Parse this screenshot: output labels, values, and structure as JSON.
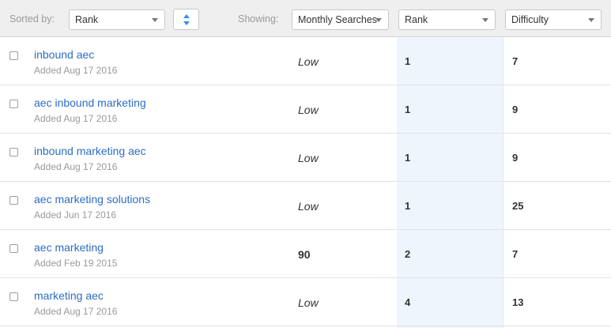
{
  "toolbar": {
    "sorted_by_label": "Sorted by:",
    "sorted_by_value": "Rank",
    "showing_label": "Showing:",
    "column_selects": [
      "Monthly Searches",
      "Rank",
      "Difficulty"
    ]
  },
  "rows": [
    {
      "keyword": "inbound aec",
      "added": "Added Aug 17 2016",
      "monthly_searches": "Low",
      "rank": "1",
      "difficulty": "7"
    },
    {
      "keyword": "aec inbound marketing",
      "added": "Added Aug 17 2016",
      "monthly_searches": "Low",
      "rank": "1",
      "difficulty": "9"
    },
    {
      "keyword": "inbound marketing aec",
      "added": "Added Aug 17 2016",
      "monthly_searches": "Low",
      "rank": "1",
      "difficulty": "9"
    },
    {
      "keyword": "aec marketing solutions",
      "added": "Added Jun 17 2016",
      "monthly_searches": "Low",
      "rank": "1",
      "difficulty": "25"
    },
    {
      "keyword": "aec marketing",
      "added": "Added Feb 19 2015",
      "monthly_searches": "90",
      "rank": "2",
      "difficulty": "7"
    },
    {
      "keyword": "marketing aec",
      "added": "Added Aug 17 2016",
      "monthly_searches": "Low",
      "rank": "4",
      "difficulty": "13"
    }
  ],
  "colors": {
    "link": "#2c6ec4",
    "rank_highlight": "#eef5fd",
    "toolbar_bg": "#efefef",
    "sort_arrow": "#3a8ee6"
  },
  "icons": {
    "sort_direction": "sort-arrows-icon",
    "dropdown": "chevron-down-icon"
  }
}
